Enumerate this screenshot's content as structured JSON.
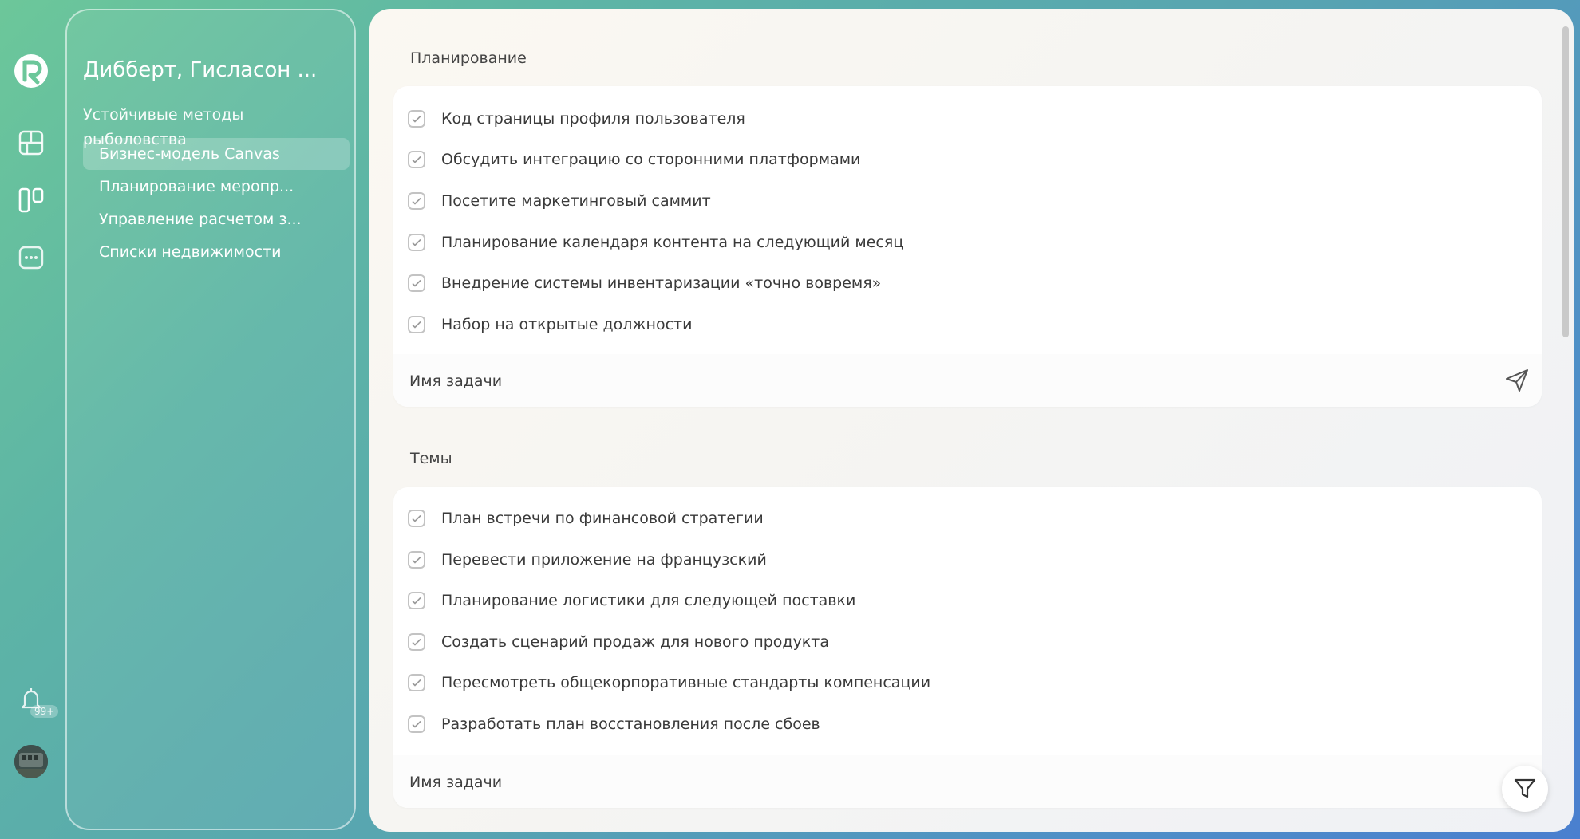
{
  "sidebar": {
    "badge": "99+",
    "icons": [
      "logo-icon",
      "dashboard-icon",
      "board-icon",
      "chat-icon",
      "bell-icon"
    ]
  },
  "project": {
    "title": "Дибберт, Гисласон ...",
    "subtitle": "Устойчивые методы рыболовства",
    "items": [
      {
        "label": "Бизнес-модель Canvas",
        "active": true
      },
      {
        "label": "Планирование меропр...",
        "active": false
      },
      {
        "label": "Управление расчетом з...",
        "active": false
      },
      {
        "label": "Списки недвижимости",
        "active": false
      }
    ]
  },
  "sections": [
    {
      "title": "Планирование",
      "tasks": [
        "Код страницы профиля пользователя",
        "Обсудить интеграцию со сторонними платформами",
        "Посетите маркетинговый саммит",
        "Планирование календаря контента на следующий месяц",
        "Внедрение системы инвентаризации «точно вовремя»",
        "Набор на открытые должности"
      ],
      "input_placeholder": "Имя задачи"
    },
    {
      "title": "Темы",
      "tasks": [
        "План встречи по финансовой стратегии",
        "Перевести приложение на французский",
        "Планирование логистики для следующей поставки",
        "Создать сценарий продаж для нового продукта",
        "Пересмотреть общекорпоративные стандарты компенсации",
        "Разработать план восстановления после сбоев"
      ],
      "input_placeholder": "Имя задачи"
    }
  ],
  "colors": {
    "gradient_start": "#6cc79a",
    "gradient_end": "#4a7fcf",
    "card_background": "#ffffff",
    "checkbox_border": "#c3c3c3"
  }
}
